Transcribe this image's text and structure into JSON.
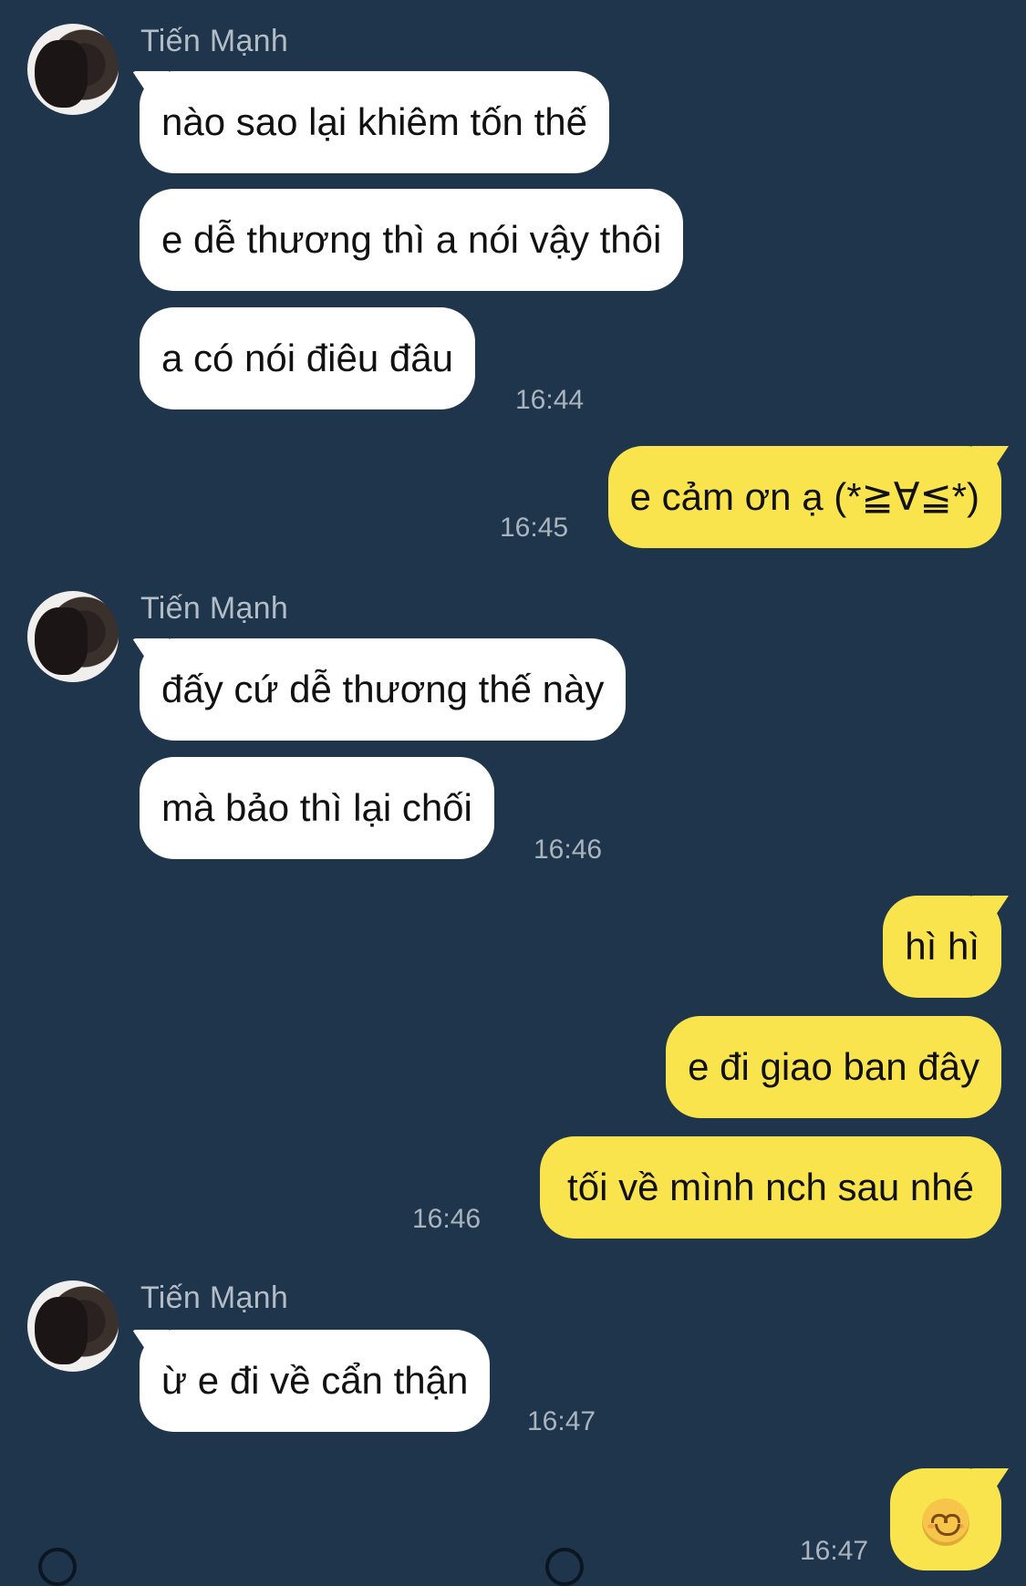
{
  "groups": {
    "g1": {
      "sender": "Tiến Mạnh",
      "messages": [
        "nào sao lại khiêm tốn thế",
        "e dễ thương thì a nói vậy thôi",
        "a có nói điêu đâu"
      ],
      "time": "16:44"
    },
    "g2": {
      "messages": [
        "e cảm ơn ạ (*≧∀≦*)"
      ],
      "time": "16:45"
    },
    "g3": {
      "sender": "Tiến Mạnh",
      "messages": [
        "đấy cứ dễ thương thế này",
        "mà bảo thì lại chối"
      ],
      "time": "16:46"
    },
    "g4": {
      "messages": [
        "hì hì",
        "e đi giao ban đây",
        "tối về mình nch sau nhé"
      ],
      "time": "16:46"
    },
    "g5": {
      "sender": "Tiến Mạnh",
      "messages": [
        "ừ e đi về cẩn thận"
      ],
      "time": "16:47"
    },
    "g6": {
      "messages": [
        "smiling-face-emoji"
      ],
      "time": "16:47"
    }
  },
  "colors": {
    "background": "#1f354b",
    "incoming_bubble": "#ffffff",
    "outgoing_bubble": "#f9e44d",
    "meta_text": "#a9b4bf"
  }
}
